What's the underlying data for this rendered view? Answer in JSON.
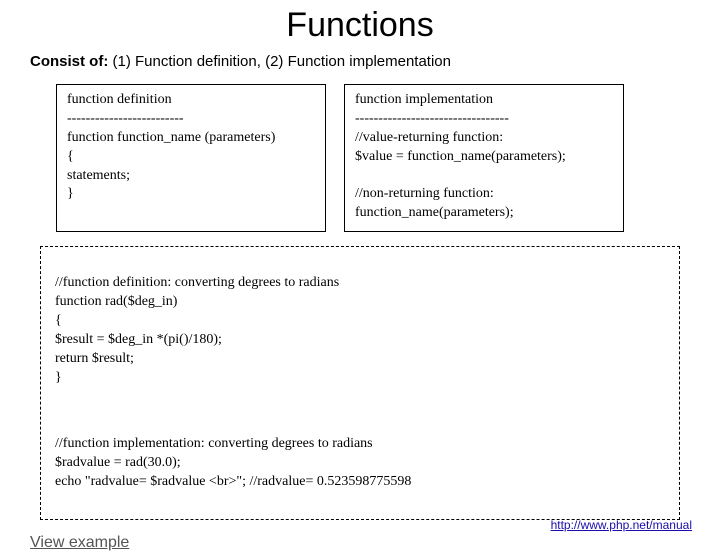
{
  "title": "Functions",
  "subtitle_label": "Consist of:",
  "subtitle_rest": " (1) Function definition, (2) Function implementation",
  "box_definition": "function definition\n-------------------------\nfunction function_name (parameters)\n{\n  statements;\n}",
  "box_implementation": "function implementation\n---------------------------------\n//value-returning function:\n$value = function_name(parameters);\n\n//non-returning function:\nfunction_name(parameters);",
  "example_definition": "//function definition: converting degrees to radians\nfunction rad($deg_in)\n{\n  $result = $deg_in *(pi()/180);\n  return $result;\n}",
  "example_implementation": "//function implementation: converting degrees to radians\n$radvalue = rad(30.0);\necho \"radvalue= $radvalue <br>\";  //radvalue= 0.523598775598",
  "view_example": "View example",
  "footer_url": "http://www.php.net/manual"
}
